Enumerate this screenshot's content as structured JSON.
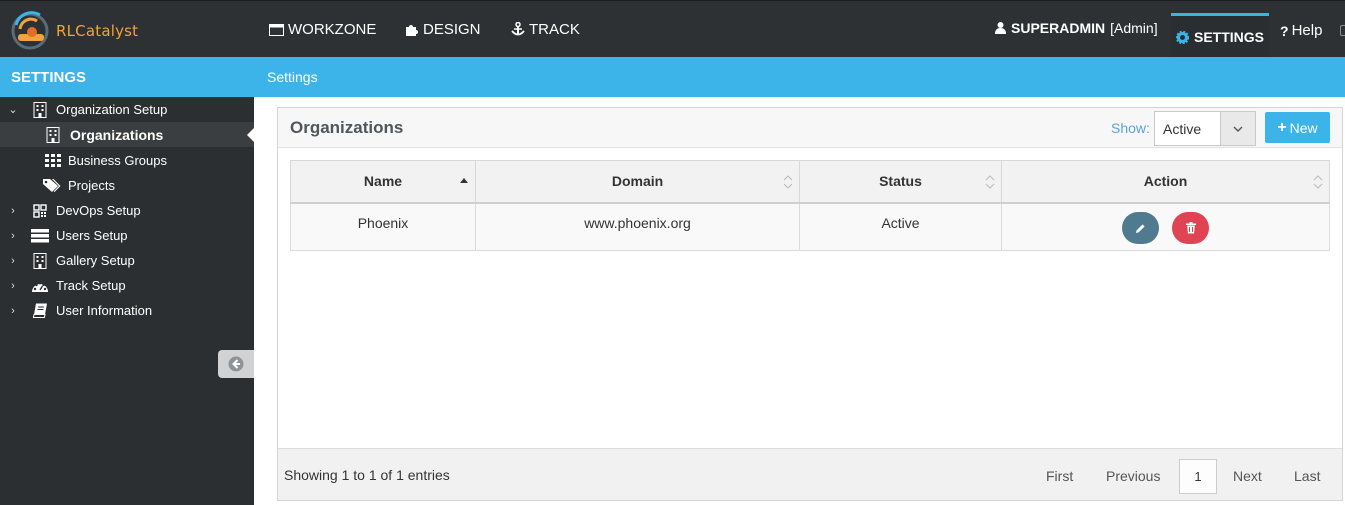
{
  "app": {
    "logo_text": "RLCatalyst"
  },
  "topnav": {
    "items": [
      {
        "label": "WORKZONE",
        "icon": "window-icon"
      },
      {
        "label": "DESIGN",
        "icon": "puzzle-icon"
      },
      {
        "label": "TRACK",
        "icon": "anchor-icon"
      }
    ],
    "user_name": "SUPERADMIN",
    "user_role": "[Admin]",
    "settings_label": "SETTINGS",
    "help_label": "Help"
  },
  "sidebar": {
    "title": "SETTINGS",
    "items": [
      {
        "label": "Organization Setup",
        "icon": "building-icon",
        "expanded": true
      },
      {
        "label": "Organizations",
        "icon": "building-icon",
        "active": true
      },
      {
        "label": "Business Groups",
        "icon": "grid-icon"
      },
      {
        "label": "Projects",
        "icon": "tags-icon"
      },
      {
        "label": "DevOps Setup",
        "icon": "qrcode-icon"
      },
      {
        "label": "Users Setup",
        "icon": "server-icon"
      },
      {
        "label": "Gallery Setup",
        "icon": "building-icon"
      },
      {
        "label": "Track Setup",
        "icon": "dashboard-icon"
      },
      {
        "label": "User Information",
        "icon": "book-icon"
      }
    ]
  },
  "breadcrumb": "Settings",
  "panel": {
    "title": "Organizations",
    "show_label": "Show:",
    "show_value": "Active",
    "new_label": "New",
    "columns": [
      "Name",
      "Domain",
      "Status",
      "Action"
    ],
    "rows": [
      {
        "name": "Phoenix",
        "domain": "www.phoenix.org",
        "status": "Active"
      }
    ],
    "footer": {
      "entries_text": "Showing 1 to 1 of 1 entries",
      "first": "First",
      "previous": "Previous",
      "current_page": "1",
      "next": "Next",
      "last": "Last"
    }
  },
  "colors": {
    "accent": "#3cb4ea",
    "nav_bg": "#2d3133",
    "edit_button": "#4f7a8f",
    "delete_button": "#e04352",
    "logo": "#f2a33a"
  }
}
